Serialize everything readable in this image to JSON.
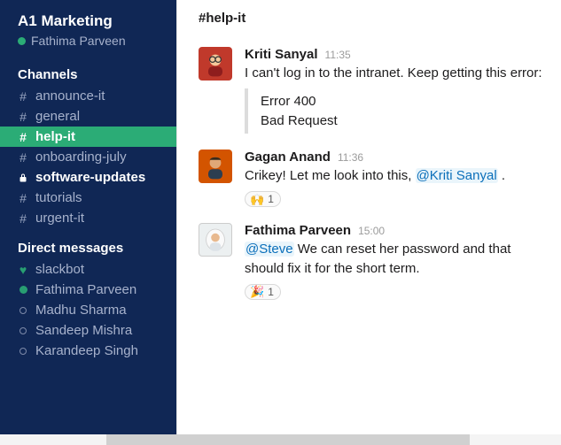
{
  "workspace": {
    "name": "A1 Marketing",
    "current_user": "Fathima Parveen"
  },
  "sidebar": {
    "channels_label": "Channels",
    "dm_label": "Direct messages",
    "channels": [
      {
        "name": "announce-it",
        "prefix": "hash",
        "state": "normal"
      },
      {
        "name": "general",
        "prefix": "hash",
        "state": "normal"
      },
      {
        "name": "help-it",
        "prefix": "hash",
        "state": "selected"
      },
      {
        "name": "onboarding-july",
        "prefix": "hash",
        "state": "normal"
      },
      {
        "name": "software-updates",
        "prefix": "lock",
        "state": "unread"
      },
      {
        "name": "tutorials",
        "prefix": "hash",
        "state": "normal"
      },
      {
        "name": "urgent-it",
        "prefix": "hash",
        "state": "normal"
      }
    ],
    "dms": [
      {
        "name": "slackbot",
        "presence": "heart"
      },
      {
        "name": "Fathima Parveen",
        "presence": "active"
      },
      {
        "name": "Madhu Sharma",
        "presence": "away"
      },
      {
        "name": "Sandeep Mishra",
        "presence": "away"
      },
      {
        "name": "Karandeep Singh",
        "presence": "away"
      }
    ]
  },
  "channel": {
    "header": "#help-it"
  },
  "messages": [
    {
      "author": "Kriti Sanyal",
      "time": "11:35",
      "text": "I can't log in to the intranet. Keep getting this error:",
      "code": [
        "Error 400",
        "Bad Request"
      ],
      "avatar": "kriti"
    },
    {
      "author": "Gagan Anand",
      "time": "11:36",
      "pre": "Crikey! Let me look into this, ",
      "mention": "@Kriti Sanyal",
      "post": " .",
      "reaction_emoji": "🙌",
      "reaction_count": "1",
      "avatar": "gagan"
    },
    {
      "author": "Fathima Parveen",
      "time": "15:00",
      "mention": "@Steve",
      "post": " We can reset her password and that should fix it for the short term.",
      "reaction_emoji": "🎉",
      "reaction_count": "1",
      "avatar": "fathima"
    }
  ]
}
